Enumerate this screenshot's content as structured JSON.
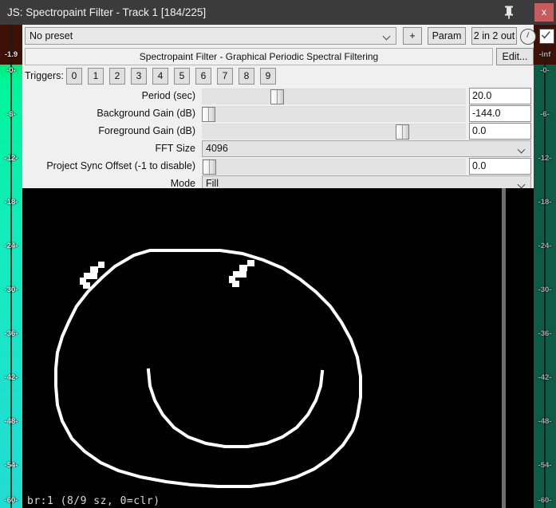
{
  "window": {
    "title": "JS: Spectropaint Filter - Track 1 [184/225]",
    "pin_icon": "pin-icon",
    "close_label": "x",
    "titlebar_color": "#3b3b3b",
    "close_color": "#c75c5c"
  },
  "toolbar": {
    "preset_value": "No preset",
    "add_label": "+",
    "param_label": "Param",
    "io_label": "2 in 2 out",
    "knob_icon": "knob-icon",
    "checkbox_icon": "checkmark-icon"
  },
  "description": {
    "text": "Spectropaint Filter - Graphical Periodic Spectral Filtering",
    "edit_label": "Edit..."
  },
  "triggers": {
    "label": "Triggers:",
    "buttons": [
      "0",
      "1",
      "2",
      "3",
      "4",
      "5",
      "6",
      "7",
      "8",
      "9"
    ]
  },
  "parameters": [
    {
      "label": "Period (sec)",
      "control": "slider",
      "value": "20.0",
      "thumb_pct": 27.5
    },
    {
      "label": "Background Gain (dB)",
      "control": "slider",
      "value": "-144.0",
      "thumb_pct": 0.0
    },
    {
      "label": "Foreground Gain (dB)",
      "control": "slider",
      "value": "0.0",
      "thumb_pct": 74.8
    },
    {
      "label": "FFT Size",
      "control": "combo",
      "value": "4096"
    },
    {
      "label": "Project Sync Offset (-1 to disable)",
      "control": "slider",
      "value": "0.0",
      "thumb_pct": 0.5
    },
    {
      "label": "Mode",
      "control": "combo",
      "value": "Fill"
    }
  ],
  "canvas": {
    "status": "br:1 (8/9 sz, 0=clr)",
    "background": "#000000",
    "stroke_color": "#ffffff",
    "drawing_name": "smiley-face"
  },
  "meters": {
    "left": {
      "peak_label": "-1.9",
      "ticks": [
        "-0-",
        "-6-",
        "-12-",
        "-18-",
        "-24-",
        "-30-",
        "-36-",
        "-42-",
        "-48-",
        "-54-",
        "-60-"
      ],
      "clip_color": "#3d1106",
      "level_color": "#12ecbb"
    },
    "right": {
      "peak_label": "-inf",
      "ticks": [
        "-0-",
        "-6-",
        "-12-",
        "-18-",
        "-24-",
        "-30-",
        "-36-",
        "-42-",
        "-48-",
        "-54-",
        "-60-"
      ],
      "clip_color": "#3d1106",
      "level_color": "#0d5c43"
    }
  }
}
